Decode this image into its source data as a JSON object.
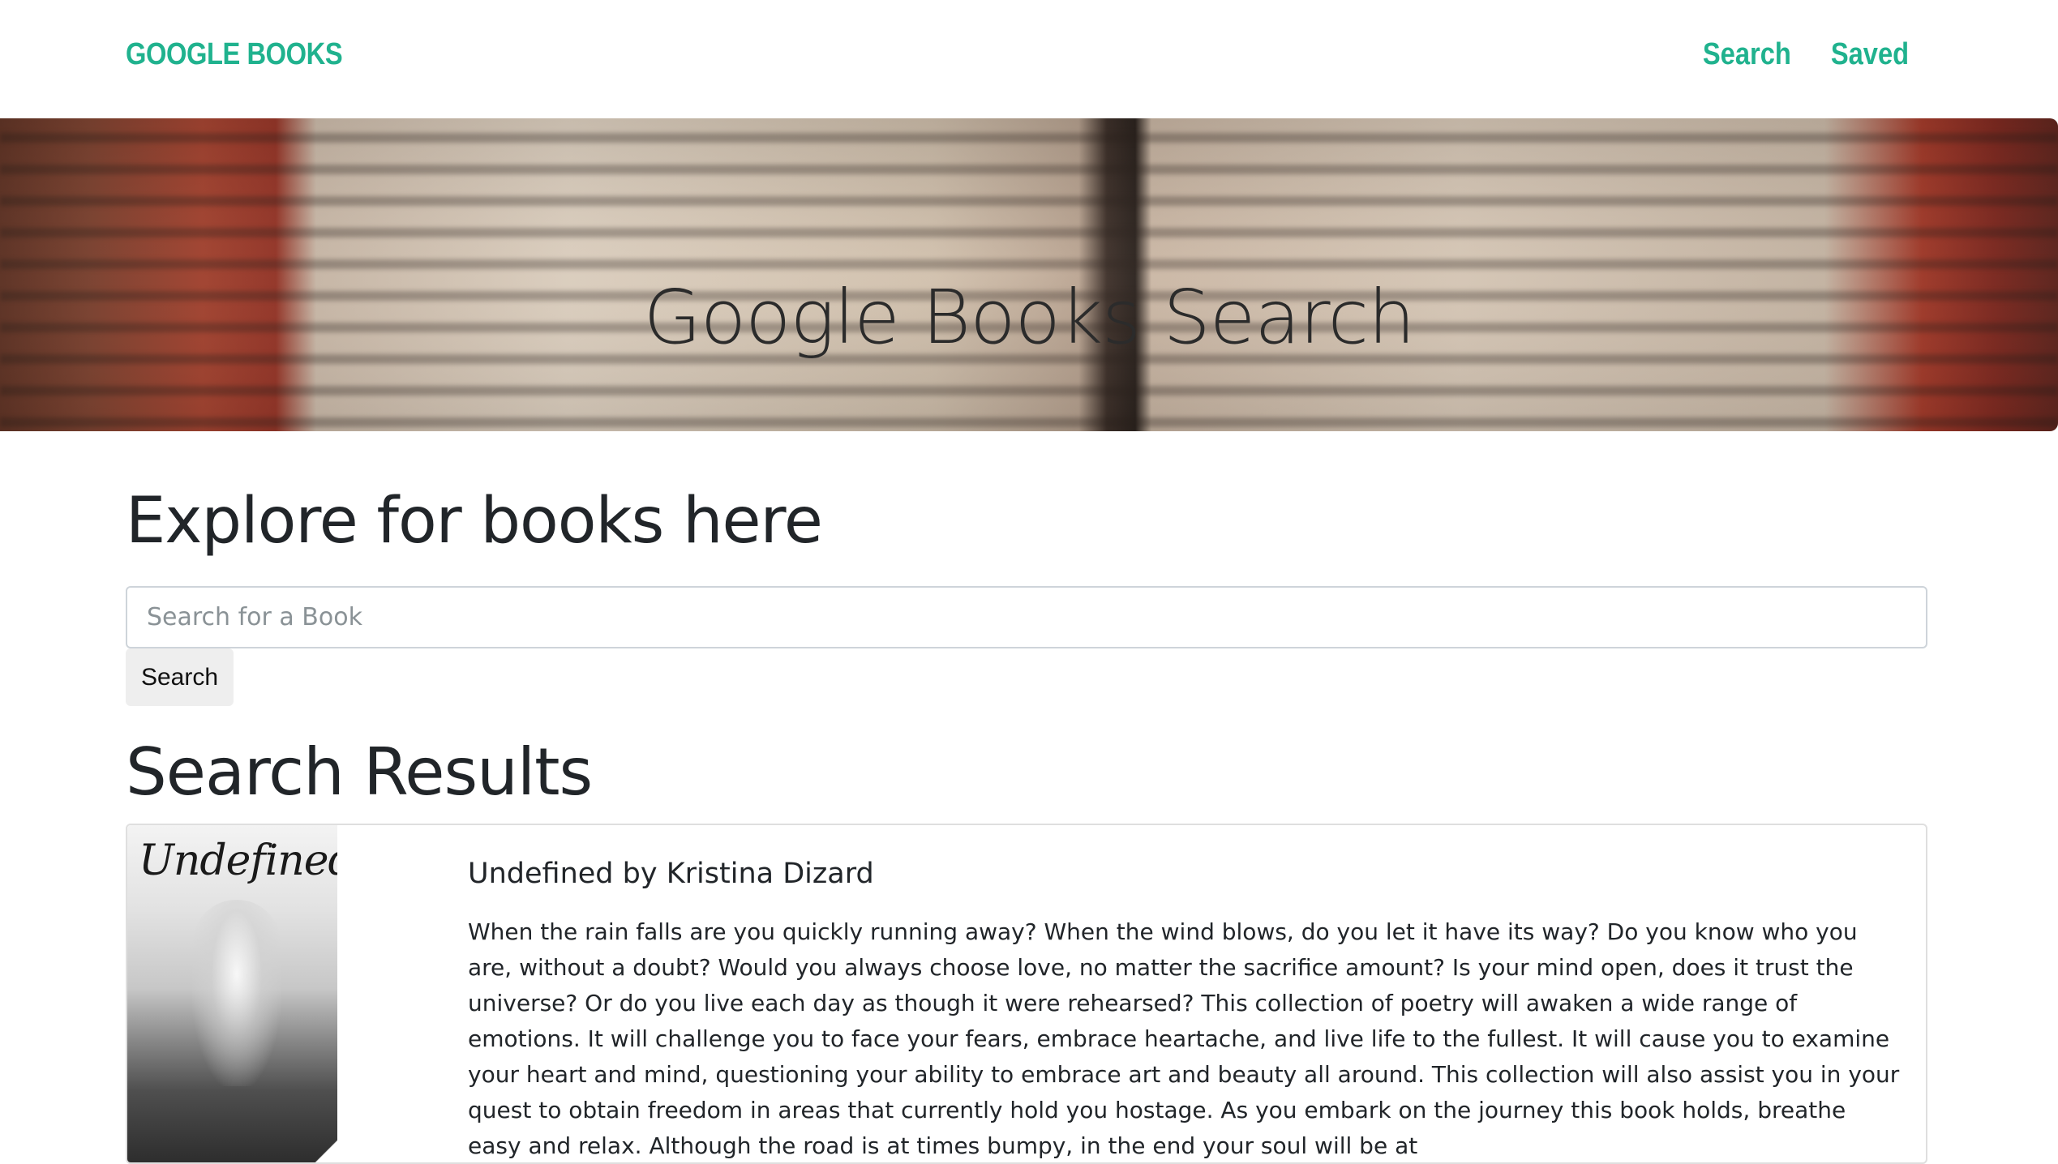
{
  "navbar": {
    "brand": "GOOGLE BOOKS",
    "links": [
      {
        "label": "Search"
      },
      {
        "label": "Saved"
      }
    ],
    "accent_color": "#20b28e"
  },
  "hero": {
    "title": "Google Books Search"
  },
  "main": {
    "explore_heading": "Explore for books here",
    "search": {
      "placeholder": "Search for a Book",
      "value": "",
      "button_label": "Search"
    },
    "results_heading": "Search Results",
    "results": [
      {
        "cover_text": "Undefined",
        "title_line": "Undefined by Kristina Dizard",
        "description": "When the rain falls are you quickly running away? When the wind blows, do you let it have its way? Do you know who you are, without a doubt? Would you always choose love, no matter the sacrifice amount? Is your mind open, does it trust the universe? Or do you live each day as though it were rehearsed? This collection of poetry will awaken a wide range of emotions. It will challenge you to face your fears, embrace heartache, and live life to the fullest. It will cause you to examine your heart and mind, questioning your ability to embrace art and beauty all around. This collection will also assist you in your quest to obtain freedom in areas that currently hold you hostage. As you embark on the journey this book holds, breathe easy and relax. Although the road is at times bumpy, in the end your soul will be at"
      }
    ]
  }
}
